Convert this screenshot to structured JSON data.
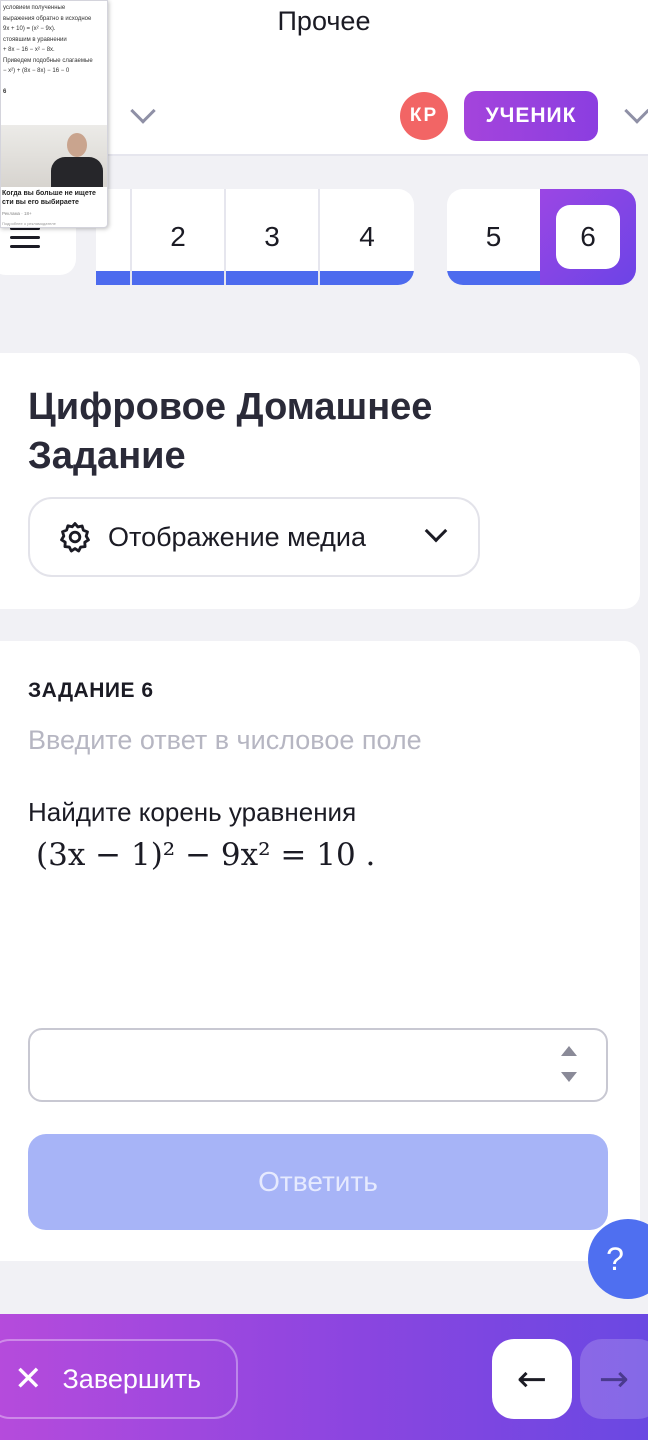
{
  "header": {
    "title": "Прочее",
    "avatar_initials": "КР",
    "role_label": "УЧЕНИК"
  },
  "task_nav": {
    "numbers": [
      "2",
      "3",
      "4",
      "5",
      "6"
    ],
    "active_number": "6",
    "progress_color": "#4d6bee"
  },
  "homework": {
    "title": "Цифровое Домашнее Задание",
    "media_select_label": "Отображение медиа"
  },
  "task": {
    "label": "ЗАДАНИЕ 6",
    "hint": "Введите ответ в числовое поле",
    "text": "Найдите корень уравнения",
    "equation": "(3x − 1)² − 9x² = 10 .",
    "answer_value": "",
    "submit_label": "Ответить"
  },
  "help": {
    "label": "?"
  },
  "bottom": {
    "finish_label": "Завершить",
    "finish_icon": "close-icon",
    "prev_icon": "arrow-left-icon",
    "next_icon": "arrow-right-icon"
  },
  "pip_overlay": {
    "lines": [
      "условием полученные",
      "выражения обратно в исходное",
      "9x + 10) = (x² − 9x).",
      "стоявшим в уравнении",
      "+ 8x − 16 − x² − 8x.",
      "Приведем подобные слагаемые",
      "− x²) + (8x − 8x) − 16 − 0",
      "",
      "6"
    ],
    "caption": "Когда вы больше не ищете сти вы его выбираете",
    "small_line_1": "Реклама · 18+",
    "small_line_2": "Подробнее о рекламодателе"
  },
  "colors": {
    "accent": "#4d6bee",
    "avatar": "#f26565",
    "role": "#9b42df",
    "submit_disabled": "#a7b4f7"
  }
}
